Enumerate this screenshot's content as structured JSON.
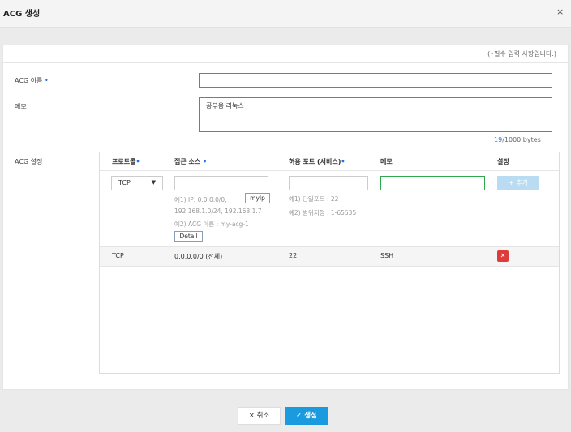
{
  "dialog": {
    "title": "ACG 생성",
    "close_icon": "×"
  },
  "notice": {
    "open": "(",
    "dot": "•",
    "text": "필수 입력 사항입니다.)"
  },
  "form": {
    "acg_name_label": "ACG 이름",
    "required_dot": "•",
    "acg_name_value": "",
    "memo_label": "메모",
    "memo_value": "공부용 리눅스",
    "byte_count": "19",
    "byte_limit": "/1000 bytes",
    "acg_settings_label": "ACG 설정"
  },
  "table": {
    "headers": {
      "protocol": "프로토콜",
      "source": "접근 소스",
      "port": "허용 포트 (서비스)",
      "memo": "메모",
      "settings": "설정"
    },
    "input_row": {
      "protocol_selected": "TCP",
      "caret": "▼",
      "myip_button": "myIp",
      "source_hint_1": "예1) IP: 0.0.0.0/0,",
      "source_hint_2": "192.168.1.0/24, 192.168.1.7",
      "source_hint_3": "예2) ACG 이름 : my-acg-1",
      "detail_button": "Detail",
      "port_hint_1": "예1) 단일포트 : 22",
      "port_hint_2": "예2) 범위지정 : 1-65535",
      "add_button": "+ 추가"
    },
    "rows": [
      {
        "protocol": "TCP",
        "source": "0.0.0.0/0 (전체)",
        "port": "22",
        "memo": "SSH"
      }
    ],
    "delete_icon": "✕"
  },
  "footer": {
    "cancel_label": "× 취소",
    "create_label": "✓ 생성"
  },
  "colors": {
    "accent": "#1a9be0",
    "input_border": "#2fa84f",
    "delete": "#e03b3b"
  }
}
